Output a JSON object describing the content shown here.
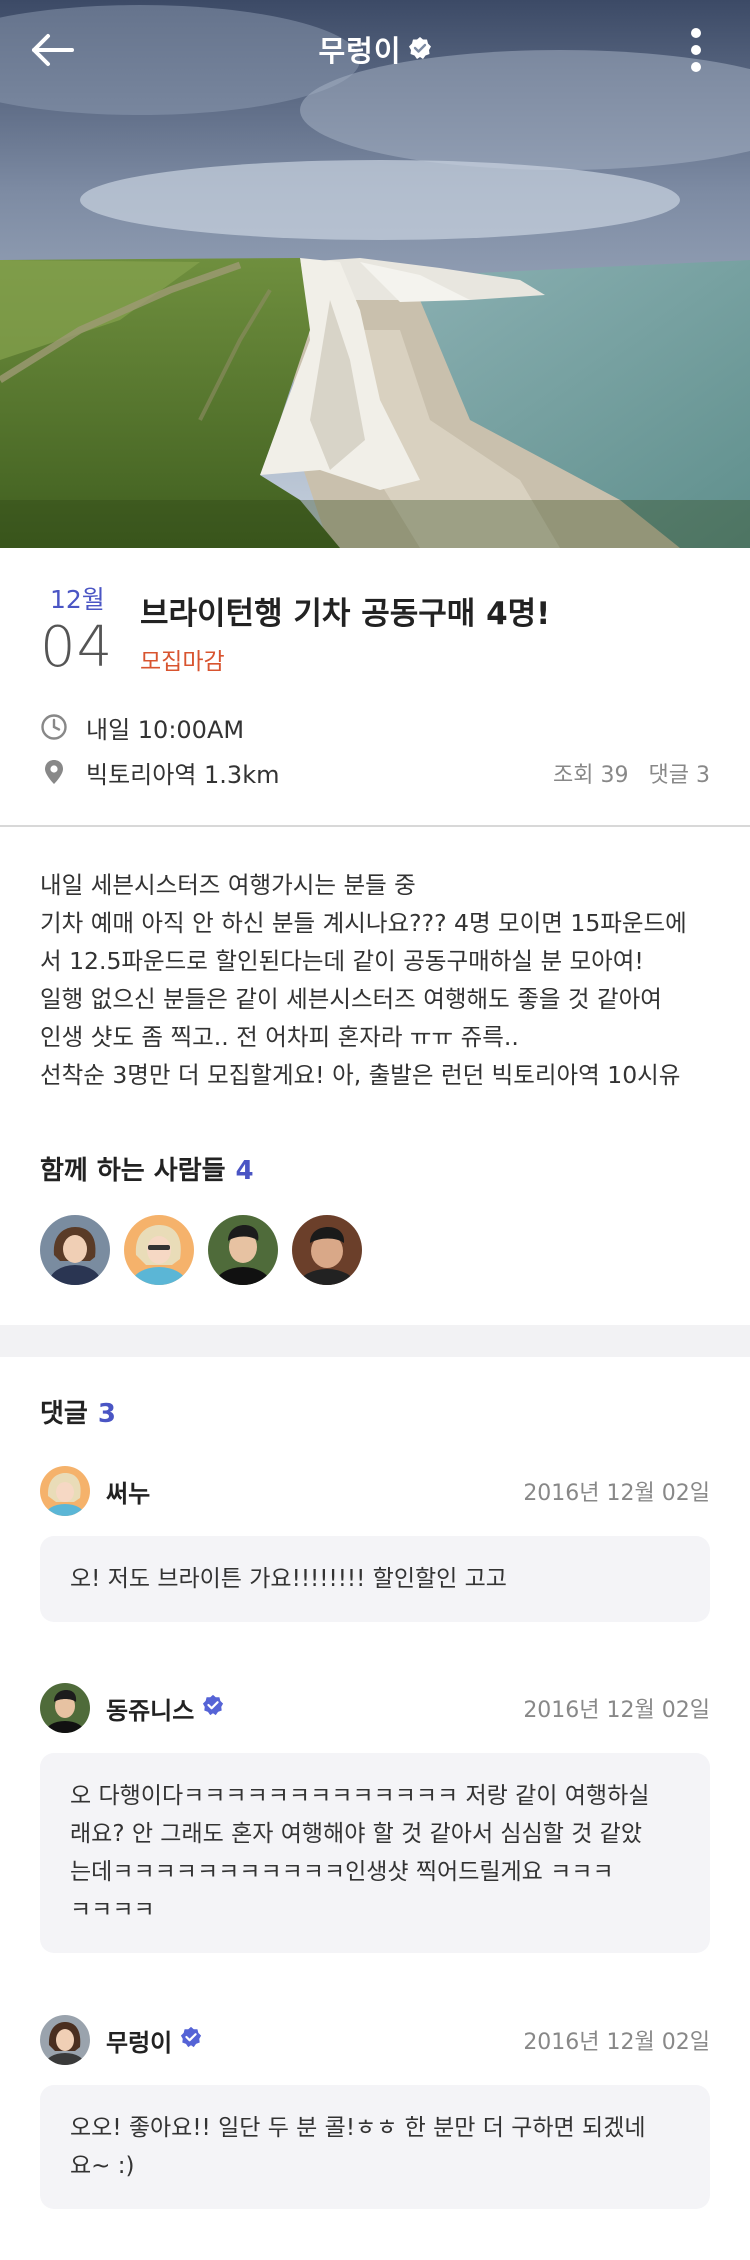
{
  "header": {
    "title": "무렁이",
    "back_icon": "back-arrow-icon",
    "menu_icon": "more-vertical-icon",
    "verified_icon": "verified-badge-icon"
  },
  "event": {
    "month": "12월",
    "day": "04",
    "title": "브라이턴행 기차 공동구매 4명!",
    "status": "모집마감",
    "time": "내일 10:00AM",
    "location": "빅토리아역  1.3km",
    "views": "조회 39",
    "comments_count_label": "댓글 3"
  },
  "description": {
    "lines": [
      "내일 세븐시스터즈 여행가시는 분들 중",
      "기차 예매 아직 안 하신 분들 계시나요??? 4명 모이면 15파운드에",
      "서 12.5파운드로 할인된다는데 같이 공동구매하실 분 모아여!",
      "일행 없으신 분들은 같이 세븐시스터즈 여행해도 좋을 것 같아여",
      "인생 샷도 좀 찍고.. 전 어차피 혼자라 ㅠㅠ 쥬륵..",
      "선착순 3명만 더 모집할게요! 아, 출발은 런던 빅토리아역 10시유"
    ]
  },
  "members": {
    "title": "함께 하는 사람들",
    "count": "4"
  },
  "comments": {
    "title": "댓글",
    "count": "3",
    "items": [
      {
        "name": "써누",
        "date": "2016년 12월 02일",
        "lines": [
          "오! 저도 브라이튼 가요!!!!!!!! 할인할인 고고"
        ]
      },
      {
        "name": "동쥬니스",
        "date": "2016년 12월 02일",
        "lines": [
          "오 다행이다ㅋㅋㅋㅋㅋㅋㅋㅋㅋㅋㅋㅋㅋ 저랑 같이 여행하실",
          "래요? 안 그래도 혼자 여행해야 할 것 같아서 심심할 것 같았",
          "는데ㅋㅋㅋㅋㅋㅋㅋㅋㅋㅋㅋ인생샷 찍어드릴게요 ㅋㅋㅋ",
          "ㅋㅋㅋㅋ"
        ]
      },
      {
        "name": "무렁이",
        "date": "2016년 12월 02일",
        "lines": [
          "오오! 좋아요!! 일단 두 분 콜!ㅎㅎ 한 분만 더 구하면 되겠네",
          "요~ :)"
        ]
      }
    ]
  },
  "colors": {
    "accent": "#4a55c4",
    "status": "#d8542f",
    "verified": "#5563d6"
  }
}
